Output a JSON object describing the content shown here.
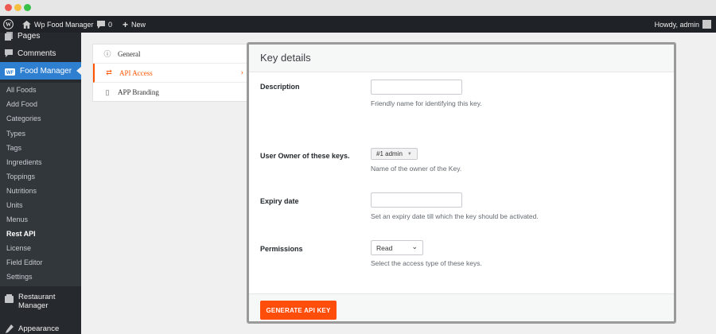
{
  "admin_bar": {
    "site_name": "Wp Food Manager",
    "comments_count": "0",
    "new_label": "New",
    "howdy": "Howdy, admin"
  },
  "sidebar": {
    "top_items": [
      {
        "label": "Pages",
        "icon": "pages-icon"
      },
      {
        "label": "Comments",
        "icon": "comments-icon"
      }
    ],
    "active_menu": {
      "label": "Food Manager",
      "icon": "food-manager-icon"
    },
    "submenu": [
      "All Foods",
      "Add Food",
      "Categories",
      "Types",
      "Tags",
      "Ingredients",
      "Toppings",
      "Nutritions",
      "Units",
      "Menus",
      "Rest API",
      "License",
      "Field Editor",
      "Settings"
    ],
    "current_submenu": "Rest API",
    "bottom_items": [
      {
        "label": "Restaurant Manager",
        "label_line1": "Restaurant",
        "label_line2": "Manager",
        "icon": "restaurant-icon"
      },
      {
        "label": "Appearance",
        "icon": "appearance-icon"
      }
    ]
  },
  "tabs": [
    {
      "label": "General",
      "icon": "info-icon",
      "active": false
    },
    {
      "label": "API Access",
      "icon": "swap-arrows-icon",
      "active": true
    },
    {
      "label": "APP Branding",
      "icon": "mobile-icon",
      "active": false
    }
  ],
  "panel": {
    "title": "Key details",
    "fields": {
      "description": {
        "label": "Description",
        "value": "",
        "help": "Friendly name for identifying this key."
      },
      "owner": {
        "label": "User Owner of these keys.",
        "value": "#1 admin",
        "help": "Name of the owner of the Key."
      },
      "expiry": {
        "label": "Expiry date",
        "value": "",
        "help": "Set an expiry date till which the key should be activated."
      },
      "permissions": {
        "label": "Permissions",
        "value": "Read",
        "help": "Select the access type of these keys."
      }
    },
    "generate_button": "GENERATE API KEY"
  },
  "colors": {
    "accent": "#ff4d0a",
    "admin_bar": "#1f2327",
    "sidebar": "#262a2e",
    "active_menu": "#2f7fd0"
  }
}
